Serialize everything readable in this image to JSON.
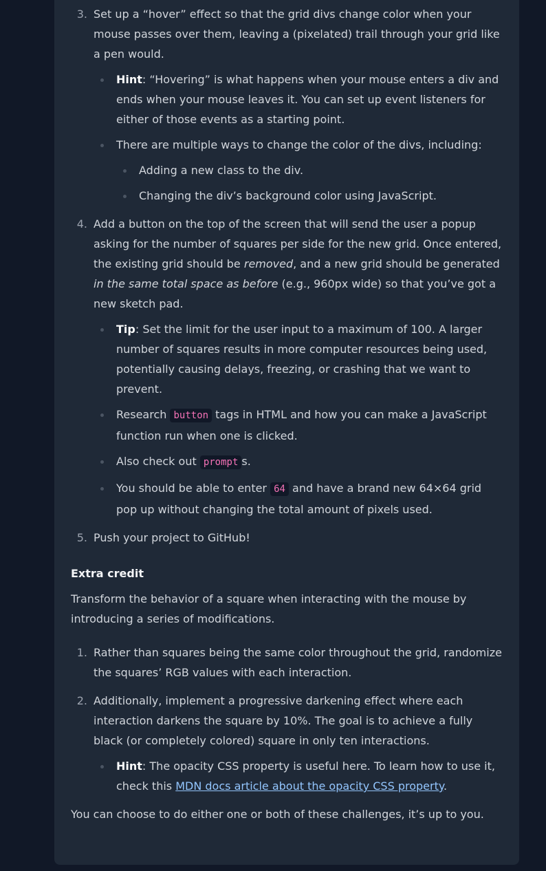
{
  "steps": [
    {
      "num": "3.",
      "text": "Set up a “hover” effect so that the grid divs change color when your mouse passes over them, leaving a (pixelated) trail through your grid like a pen would.",
      "hint_label": "Hint",
      "hint_text": ": “Hovering” is what happens when your mouse enters a div and ends when your mouse leaves it. You can set up event listeners for either of those events as a starting point.",
      "ways_text": "There are multiple ways to change the color of the divs, including:",
      "ways": [
        "Adding a new class to the div.",
        "Changing the div’s background color using JavaScript."
      ]
    },
    {
      "num": "4.",
      "text_a": "Add a button on the top of the screen that will send the user a popup asking for the number of squares per side for the new grid. Once entered, the existing grid should be ",
      "text_em1": "removed",
      "text_b": ", and a new grid should be generated ",
      "text_em2": "in the same total space as before",
      "text_c": " (e.g., 960px wide) so that you’ve got a new sketch pad.",
      "tip_label": "Tip",
      "tip_text": ": Set the limit for the user input to a maximum of 100. A larger number of squares results in more computer resources being used, potentially causing delays, freezing, or crashing that we want to prevent.",
      "research_a": "Research ",
      "research_code": "button",
      "research_b": " tags in HTML and how you can make a JavaScript function run when one is clicked.",
      "prompt_a": "Also check out ",
      "prompt_code": "prompt",
      "prompt_b": "s.",
      "enter_a": "You should be able to enter ",
      "enter_code": "64",
      "enter_b": " and have a brand new 64×64 grid pop up without changing the total amount of pixels used."
    },
    {
      "num": "5.",
      "text": "Push your project to GitHub!"
    }
  ],
  "extra": {
    "heading": "Extra credit",
    "intro": "Transform the behavior of a square when interacting with the mouse by introducing a series of modifications.",
    "items": [
      {
        "num": "1.",
        "text": "Rather than squares being the same color throughout the grid, randomize the squares’ RGB values with each interaction."
      },
      {
        "num": "2.",
        "text": "Additionally, implement a progressive darkening effect where each interaction darkens the square by 10%. The goal is to achieve a fully black (or completely colored) square in only ten interactions."
      }
    ],
    "hint_label": "Hint",
    "hint_text": ": The opacity CSS property is useful here. To learn how to use it, check this ",
    "hint_link": "MDN docs article about the opacity CSS property",
    "hint_end": ".",
    "outro": "You can choose to do either one or both of these challenges, it’s up to you."
  }
}
